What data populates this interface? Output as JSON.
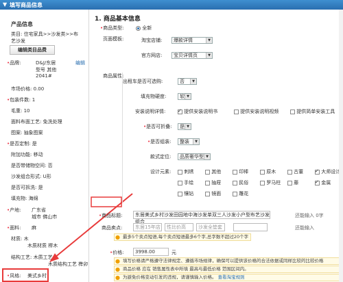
{
  "header": {
    "title": "填写商品信息"
  },
  "sidebar": {
    "heading": "产品信息",
    "category_line1": "类目: 住宅家具>>沙发类>>布",
    "category_line2": "艺沙发",
    "edit_button": "编辑类目品费",
    "brand_label": "品牌:",
    "brand_line1": "D&J/东居",
    "brand_line2": "型号 其他",
    "brand_line3": "2041#",
    "brand_edit": "编辑",
    "market_price": "市场价格: 0.00",
    "package_count": "包装件数: 1",
    "hair_volume": "毛重: 10",
    "fabric_process": "面料布面工艺: 免洗处理",
    "pattern": "图案: 抽象图案",
    "customizable": "是否定制: 是",
    "extra_func": "附加功能: 移动",
    "storage": "是否带储物空间: 否",
    "sofa_shape": "沙发组合形式: U形",
    "detachable": "是否可拆洗: 是",
    "filling": "填充物: 海绵",
    "origin_label": "产地:",
    "origin_line1": "广东省",
    "origin_line2": "城市 佛山市",
    "fabric_label": "面料:",
    "fabric_value": "麻",
    "material_line1": "材质: 木",
    "material_line2": "木质材质 榉木",
    "structure_line1": "结构工艺: 木质工艺",
    "structure_line2": "木质结构工艺 榫卯",
    "style_label": "风格:",
    "style_value": "美式乡村"
  },
  "main": {
    "section_title": "1. 商品基本信息",
    "type_label": "商品类型:",
    "type_option": "全新",
    "template_label": "页面模板:",
    "taobao_store_label": "淘宝店铺:",
    "taobao_store_value": "爆款详情",
    "official_store_label": "官方网店:",
    "official_store_value": "宝贝详情页",
    "attrs_label": "商品属性:",
    "rental_label": "出租车是否可选购:",
    "rental_value": "否",
    "hardness_label": "填充物硬度:",
    "hardness_value": "软",
    "install_label": "安装说明详情:",
    "install_options": [
      "提供安装说明书",
      "提供安装说明视频",
      "提供简单安装工具"
    ],
    "install_checked": [
      true,
      false,
      false
    ],
    "assembled_label": "是否可折叠:",
    "assembled_value": "是",
    "assembly_label": "是否组装:",
    "assembly_value": "整装",
    "style_pos_label": "款式定位:",
    "style_pos_value": "品质奢华型",
    "design_label": "设计元素:",
    "design_options": [
      [
        "刺绣",
        "其他",
        "印棒",
        "原木",
        "古董",
        "大师设计"
      ],
      [
        "手绘",
        "抽屉",
        "民俗",
        "罗马柱",
        "藤",
        "金属"
      ],
      [
        "镶钻",
        "镜面",
        "雕花",
        "",
        "",
        ""
      ]
    ],
    "design_checked": [
      [
        false,
        false,
        false,
        false,
        false,
        true
      ],
      [
        false,
        false,
        false,
        false,
        false,
        true
      ],
      [
        false,
        false,
        false,
        false,
        false,
        false
      ]
    ],
    "title_label": "商品标题:",
    "title_value": "东居美式乡村沙发田园地中海沙发单双三人沙发小户型布艺沙发组合",
    "title_counter": "还能输入 0字",
    "selling_label": "商品卖点:",
    "selling_placeholders": [
      "东居15年店",
      "性比价高",
      "沙发全垫套",
      ""
    ],
    "selling_counter": "还能输入",
    "selling_hint": "最多5个卖点短语,每个卖点短语最多6个字,总字数不超过20个字",
    "price_label": "价格:",
    "price_value": "3998.00",
    "price_unit": "元",
    "price_hint1": "填写价格请严格遵守法律规定、遵循市场规律，确保可以提供该价格的合法依据或同样比较的比较价格",
    "price_hint2": "商品价格 应在 销售属性表中所填 最高与最低价格 范围区间内。",
    "price_hint3": "为避免价格变动引发的违规，请谨慎输入价格。",
    "price_hint3_link": "查看淘宝规则"
  },
  "colors": {
    "accent": "#2a6fb0",
    "required": "#e34444",
    "highlight_box": "#e83a3a"
  }
}
